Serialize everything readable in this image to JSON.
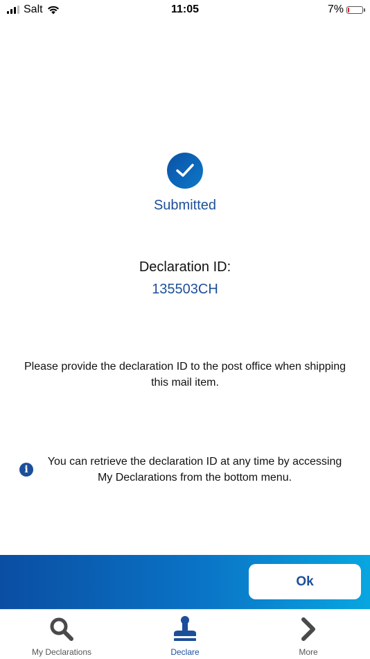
{
  "status_bar": {
    "carrier": "Salt",
    "time": "11:05",
    "battery": "7%"
  },
  "result": {
    "status": "Submitted",
    "declaration_label": "Declaration ID:",
    "declaration_id": "135503CH"
  },
  "instruction": "Please provide the declaration ID to the post office when shipping this mail item.",
  "info": {
    "icon": "i",
    "text": "You can retrieve the declaration ID at any time by accessing My Declarations from the bottom menu."
  },
  "action": {
    "ok_label": "Ok"
  },
  "tabs": [
    {
      "label": "My Declarations",
      "icon": "search-icon"
    },
    {
      "label": "Declare",
      "icon": "stamp-icon",
      "active": true
    },
    {
      "label": "More",
      "icon": "chevron-right-icon"
    }
  ],
  "colors": {
    "accent": "#1c4f9a",
    "gradient_start": "#0a4ea3",
    "gradient_end": "#08a6e0",
    "battery_low": "#e0202a"
  }
}
